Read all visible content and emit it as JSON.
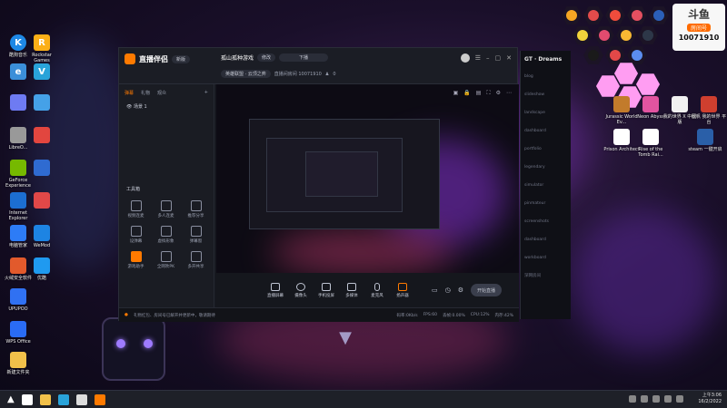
{
  "desktop": {
    "left_icons": [
      {
        "label": "K",
        "sub": "酷狗音乐",
        "color": "#1e88e5"
      },
      {
        "label": "R",
        "sub": "Rockstar Games",
        "color": "#fcaf17"
      },
      {
        "label": "e",
        "sub": "",
        "color": "#3b8fd9"
      },
      {
        "label": "V",
        "sub": "",
        "color": "#29a3d9"
      },
      {
        "label": "",
        "sub": "",
        "color": "#6e7bf2"
      },
      {
        "label": "",
        "sub": "",
        "color": "#45a1e8"
      },
      {
        "label": "",
        "sub": "LibreO...",
        "color": "#999"
      },
      {
        "label": "",
        "sub": "",
        "color": "#e2463f"
      },
      {
        "label": "",
        "sub": "GeForce Experience",
        "color": "#76b900"
      },
      {
        "label": "",
        "sub": "",
        "color": "#2f6bd1"
      },
      {
        "label": "",
        "sub": "Internet Explorer",
        "color": "#1c6ed1"
      },
      {
        "label": "",
        "sub": "",
        "color": "#e04848"
      },
      {
        "label": "",
        "sub": "电脑管家",
        "color": "#2d7cf6"
      },
      {
        "label": "",
        "sub": "WeMod",
        "color": "#1d84e3"
      },
      {
        "label": "",
        "sub": "火绒安全软件",
        "color": "#e25a2c"
      },
      {
        "label": "",
        "sub": "优酷",
        "color": "#1f9af0"
      },
      {
        "label": "",
        "sub": "UPUPOO",
        "color": "#3071f2"
      },
      {
        "label": "",
        "sub": "WPS Office",
        "color": "#2a6cf5"
      },
      {
        "label": "",
        "sub": "新建文件夹",
        "color": "#f2c14a"
      }
    ],
    "right_icons": [
      {
        "label": "Jurassic World Ev...",
        "color": "#c27b2b"
      },
      {
        "label": "Neon Abyss",
        "color": "#e254a0"
      },
      {
        "label": "我的世界 X 中国版",
        "color": "#f1f1f1"
      },
      {
        "label": "秋帆 我的世界 平台",
        "color": "#cf3f2f"
      },
      {
        "label": "Prison Architect",
        "color": "#fff"
      },
      {
        "label": "Rise of the Tomb Rai...",
        "color": "#fff"
      },
      {
        "label": "steam 一键开启",
        "color": "#2a5fa8"
      }
    ],
    "douyu_badge": {
      "brand": "斗鱼",
      "room_label": "房间号",
      "room_number": "10071910"
    }
  },
  "app": {
    "logo": "直播伴侣",
    "badge": "新版",
    "room_title": "孤山孤种游戏",
    "edit_label": "修改",
    "dropdown_label": "下播",
    "category_chip": "英雄联盟 · 云顶之弈",
    "room_info": "直播间房间 10071910",
    "viewers": "0",
    "tabs": [
      "弹幕",
      "礼物",
      "观众"
    ],
    "scene_label": "场景 1",
    "tools_title": "工具箱",
    "tools": [
      {
        "label": "视频连麦"
      },
      {
        "label": "多人连麦"
      },
      {
        "label": "推荐分享"
      },
      {
        "label": "设弹幕"
      },
      {
        "label": "虚拟形象"
      },
      {
        "label": "弹幕窗"
      },
      {
        "label": "游戏助手"
      },
      {
        "label": "全网吹PK"
      },
      {
        "label": "多开共享"
      }
    ],
    "bottom_tools": [
      {
        "label": "直播屏幕"
      },
      {
        "label": "摄像头"
      },
      {
        "label": "手机投屏"
      },
      {
        "label": "多媒体"
      },
      {
        "label": "麦克风"
      },
      {
        "label": "扬声器"
      }
    ],
    "start_button": "开始直播",
    "notice": "礼物红包、房间号已解开并更新中，敬请期待",
    "stats": [
      "码率:0Kb/s",
      "FPS:60",
      "丢帧:0.00%",
      "CPU:12%",
      "内存:42%"
    ]
  },
  "side_panel": {
    "title": "GT · Dreams",
    "items": [
      "blog",
      "slideshow",
      "landscape",
      "dashboard",
      "portfolio",
      "legendary",
      "simulator",
      "pinmateur",
      "screenshots",
      "dashboard",
      "workboard",
      "深网房间"
    ]
  },
  "taskbar": {
    "time": "上午3:06",
    "date": "16/2/2022"
  }
}
